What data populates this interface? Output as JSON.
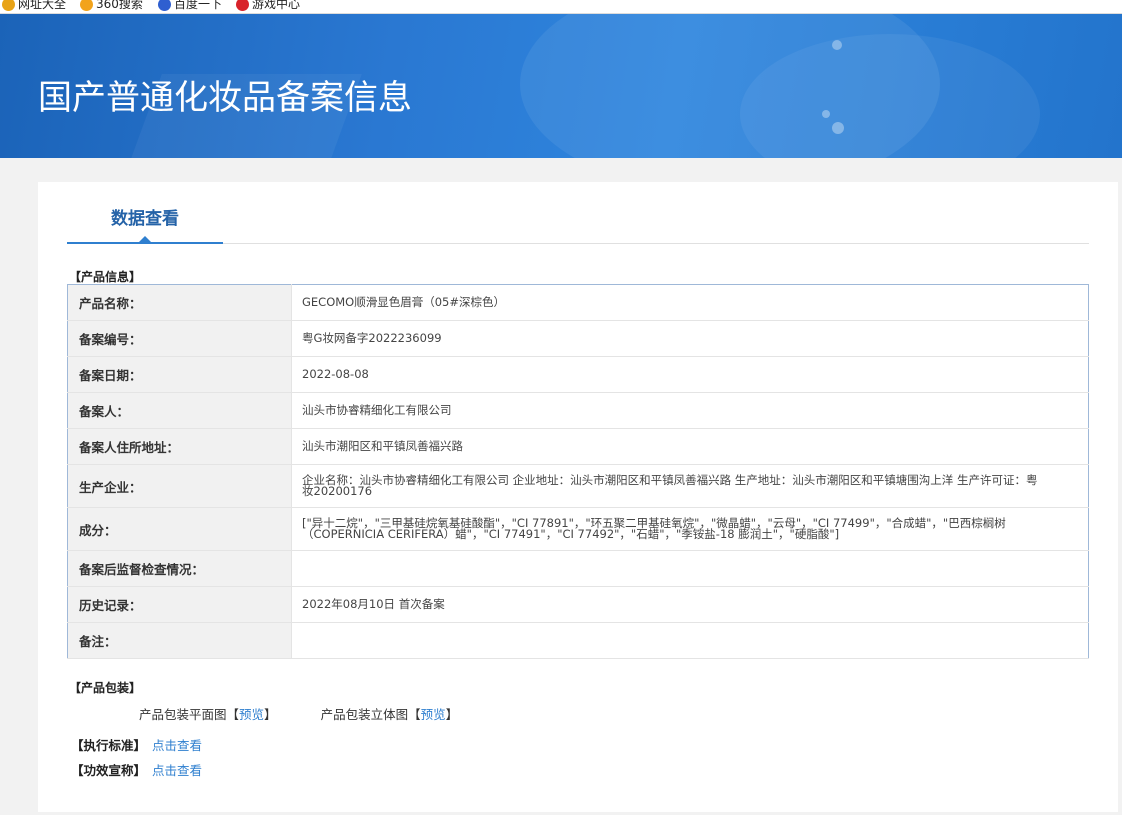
{
  "bookmarks": [
    {
      "label": "网址大全",
      "color": "#e8a317"
    },
    {
      "label": "360搜索",
      "color": "#f2a31b"
    },
    {
      "label": "百度一下",
      "color": "#2f5fd0"
    },
    {
      "label": "游戏中心",
      "color": "#d8232a"
    }
  ],
  "banner": {
    "title": "国产普通化妆品备案信息"
  },
  "tab": {
    "label": "数据查看"
  },
  "sections": {
    "product_info": "【产品信息】",
    "packaging": "【产品包装】",
    "standard": "【执行标准】",
    "claims": "【功效宣称】"
  },
  "info_rows": [
    {
      "key": "产品名称：",
      "value": "GECOMO顺滑显色眉膏（05#深棕色）"
    },
    {
      "key": "备案编号：",
      "value": "粤G妆网备字2022236099"
    },
    {
      "key": "备案日期：",
      "value": "2022-08-08"
    },
    {
      "key": "备案人：",
      "value": "汕头市协睿精细化工有限公司"
    },
    {
      "key": "备案人住所地址：",
      "value": "汕头市潮阳区和平镇凤善福兴路"
    },
    {
      "key": "生产企业：",
      "value": "企业名称：汕头市协睿精细化工有限公司 企业地址：汕头市潮阳区和平镇凤善福兴路 生产地址：汕头市潮阳区和平镇塘围沟上洋 生产许可证：粤妆20200176"
    },
    {
      "key": "成分：",
      "value": "[\"异十二烷\"，\"三甲基硅烷氧基硅酸酯\"，\"CI 77891\"，\"环五聚二甲基硅氧烷\"，\"微晶蜡\"，\"云母\"，\"CI 77499\"，\"合成蜡\"，\"巴西棕榈树（COPERNICIA CERIFERA）蜡\"，\"CI 77491\"，\"CI 77492\"，\"石蜡\"，\"季铵盐-18 膨润土\"，\"硬脂酸\"]"
    },
    {
      "key": "备案后监督检查情况：",
      "value": ""
    },
    {
      "key": "历史记录：",
      "value": "2022年08月10日 首次备案"
    },
    {
      "key": "备注：",
      "value": ""
    }
  ],
  "packaging": {
    "flat_label": "产品包装平面图",
    "flat_link": "预览",
    "solid_label": "产品包装立体图",
    "solid_link": "预览",
    "bracket_open": "【",
    "bracket_close": "】"
  },
  "standard_link": "点击查看",
  "claims_link": "点击查看"
}
